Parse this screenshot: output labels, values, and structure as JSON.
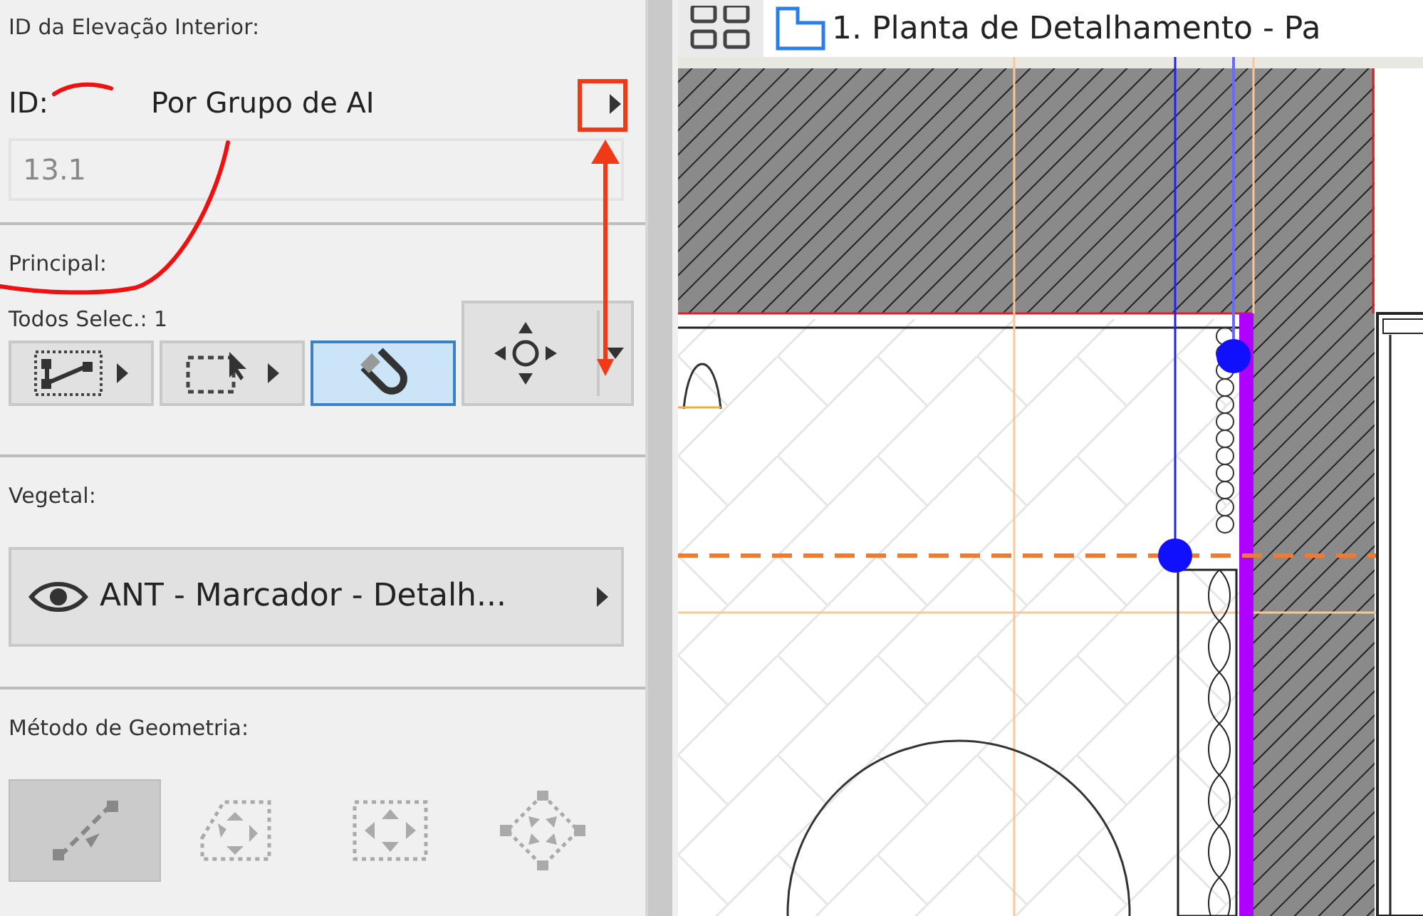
{
  "panel": {
    "id_section": {
      "title": "ID da Elevação Interior:",
      "id_label": "ID:",
      "id_mode": "Por Grupo de AI",
      "id_value": "13.1",
      "disabled": true
    },
    "principal": {
      "title": "Principal:",
      "selection_count": "Todos Selec.: 1",
      "tools": [
        {
          "kind": "polyline",
          "has_menu": true,
          "selected": false
        },
        {
          "kind": "marquee",
          "has_menu": true,
          "selected": false
        },
        {
          "kind": "magnet",
          "has_menu": false,
          "selected": true
        },
        {
          "kind": "move",
          "has_menu": true,
          "selected": false
        }
      ]
    },
    "vegetal": {
      "title": "Vegetal:",
      "layer": "ANT - Marcador - Detalh..."
    },
    "geometry": {
      "title": "Método de Geometria:",
      "methods": [
        {
          "kind": "line",
          "selected": true
        },
        {
          "kind": "polygon",
          "selected": false
        },
        {
          "kind": "rectangle",
          "selected": false
        },
        {
          "kind": "rotated",
          "selected": false
        }
      ]
    }
  },
  "view_tab": {
    "title": "1. Planta de Detalhamento - Pa"
  }
}
